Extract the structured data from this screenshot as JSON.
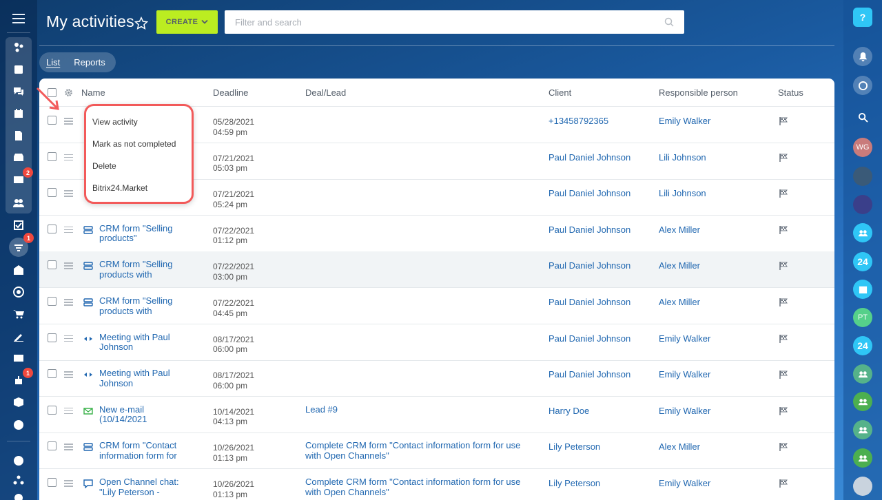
{
  "header": {
    "title": "My activities",
    "create_label": "CREATE",
    "search_placeholder": "Filter and search"
  },
  "tabs": [
    "List",
    "Reports"
  ],
  "columns": {
    "name": "Name",
    "deadline": "Deadline",
    "deal": "Deal/Lead",
    "client": "Client",
    "responsible": "Responsible person",
    "status": "Status"
  },
  "context_menu": [
    "View activity",
    "Mark as not completed",
    "Delete",
    "Bitrix24.Market"
  ],
  "rows": [
    {
      "icon": "none",
      "name1": "",
      "name2": "",
      "date": "05/28/2021",
      "time": "04:59 pm",
      "deal1": "",
      "deal2": "",
      "client": "+13458792365",
      "responsible": "Emily Walker"
    },
    {
      "icon": "none",
      "name1": "",
      "name2": "",
      "date": "07/21/2021",
      "time": "05:03 pm",
      "deal1": "",
      "deal2": "",
      "client": "Paul Daniel Johnson",
      "responsible": "Lili Johnson"
    },
    {
      "icon": "none",
      "name1": "",
      "name2": "",
      "date": "07/21/2021",
      "time": "05:24 pm",
      "deal1": "",
      "deal2": "",
      "client": "Paul Daniel Johnson",
      "responsible": "Lili Johnson"
    },
    {
      "icon": "form",
      "name1": "CRM form \"Selling",
      "name2": "products\"",
      "date": "07/22/2021",
      "time": "01:12 pm",
      "deal1": "",
      "deal2": "",
      "client": "Paul Daniel Johnson",
      "responsible": "Alex Miller"
    },
    {
      "icon": "form",
      "name1": "CRM form \"Selling",
      "name2": "products with",
      "date": "07/22/2021",
      "time": "03:00 pm",
      "deal1": "",
      "deal2": "",
      "client": "Paul Daniel Johnson",
      "responsible": "Alex Miller"
    },
    {
      "icon": "form",
      "name1": "CRM form \"Selling",
      "name2": "products with",
      "date": "07/22/2021",
      "time": "04:45 pm",
      "deal1": "",
      "deal2": "",
      "client": "Paul Daniel Johnson",
      "responsible": "Alex Miller"
    },
    {
      "icon": "meeting",
      "name1": "Meeting with Paul",
      "name2": "Johnson",
      "date": "08/17/2021",
      "time": "06:00 pm",
      "deal1": "",
      "deal2": "",
      "client": "Paul Daniel Johnson",
      "responsible": "Emily Walker"
    },
    {
      "icon": "meeting",
      "name1": "Meeting with Paul",
      "name2": "Johnson",
      "date": "08/17/2021",
      "time": "06:00 pm",
      "deal1": "",
      "deal2": "",
      "client": "Paul Daniel Johnson",
      "responsible": "Emily Walker"
    },
    {
      "icon": "email",
      "name1": "New e-mail",
      "name2": "(10/14/2021",
      "date": "10/14/2021",
      "time": "04:13 pm",
      "deal1": "Lead #9",
      "deal2": "",
      "client": "Harry Doe",
      "responsible": "Emily Walker"
    },
    {
      "icon": "form",
      "name1": "CRM form \"Contact",
      "name2": "information form for",
      "date": "10/26/2021",
      "time": "01:13 pm",
      "deal1": "Complete CRM form \"Contact information form for use",
      "deal2": "with Open Channels\"",
      "client": "Lily Peterson",
      "responsible": "Alex Miller"
    },
    {
      "icon": "chat",
      "name1": "Open Channel chat:",
      "name2": "\"Lily Peterson -",
      "date": "10/26/2021",
      "time": "01:13 pm",
      "deal1": "Complete CRM form \"Contact information form for use",
      "deal2": "with Open Channels\"",
      "client": "Lily Peterson",
      "responsible": "Emily Walker"
    }
  ],
  "left_badges": {
    "mail": "2",
    "activities": "1",
    "robot": "1"
  },
  "right_avatars": {
    "wg": "WG",
    "pt": "PT",
    "b24a": "24",
    "b24b": "24"
  },
  "colors": {
    "create": "#bbed21",
    "link": "#2067b0",
    "menu_border": "#f25a5a",
    "badge": "#f0483e",
    "help": "#2fc6f6"
  }
}
